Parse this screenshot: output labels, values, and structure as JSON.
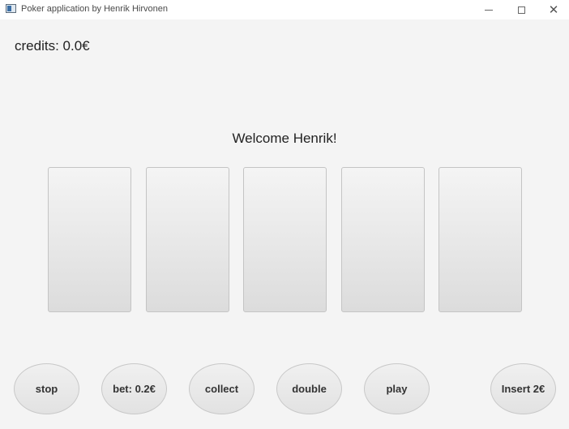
{
  "window": {
    "title": "Poker application by Henrik Hirvonen"
  },
  "credits_text": "credits: 0.0€",
  "welcome_text": "Welcome Henrik!",
  "cards": [
    {
      "slot": 1,
      "face": ""
    },
    {
      "slot": 2,
      "face": ""
    },
    {
      "slot": 3,
      "face": ""
    },
    {
      "slot": 4,
      "face": ""
    },
    {
      "slot": 5,
      "face": ""
    }
  ],
  "buttons": {
    "stop": "stop",
    "bet": "bet: 0.2€",
    "collect": "collect",
    "double": "double",
    "play": "play",
    "insert": "Insert 2€"
  }
}
